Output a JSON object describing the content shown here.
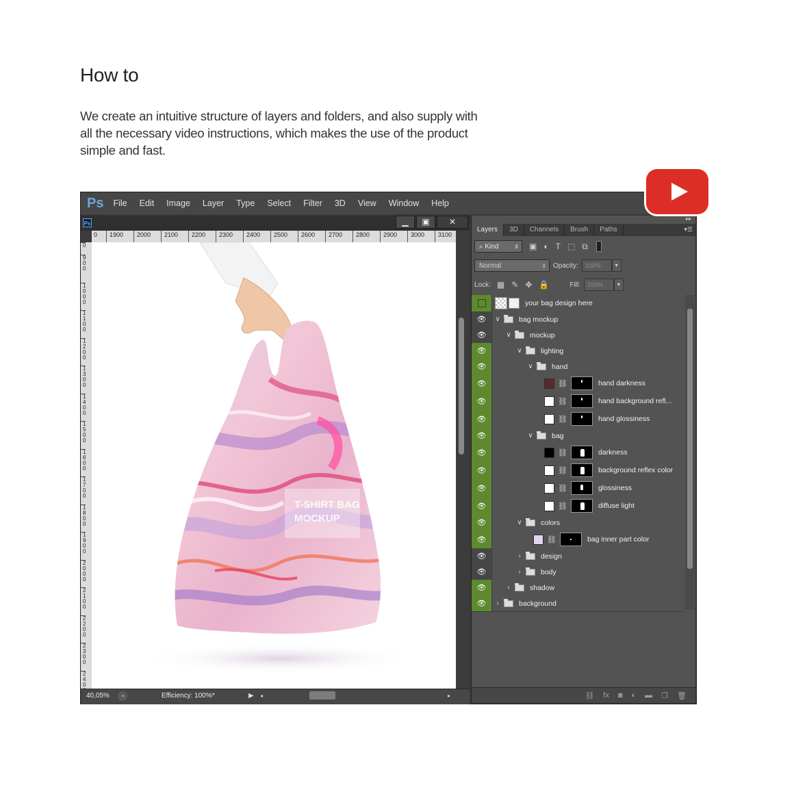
{
  "page": {
    "heading": "How to",
    "intro": "We create an intuitive structure of layers and folders, and also supply with all the necessary video instructions, which makes the use of the product simple and fast."
  },
  "colors": {
    "accent_green": "#5d8a2f",
    "youtube_red": "#dc2e27",
    "ps_blue": "#6aa7e0"
  },
  "app": {
    "logo": "Ps",
    "menu": [
      "File",
      "Edit",
      "Image",
      "Layer",
      "Type",
      "Select",
      "Filter",
      "3D",
      "View",
      "Window",
      "Help"
    ]
  },
  "document": {
    "doc_icon": "Ps",
    "ruler_h": [
      "0",
      "1900",
      "2000",
      "2100",
      "2200",
      "2300",
      "2400",
      "2500",
      "2600",
      "2700",
      "2800",
      "2900",
      "3000",
      "3100"
    ],
    "ruler_v": [
      "0",
      "900",
      "1000",
      "1100",
      "1200",
      "1300",
      "1400",
      "1500",
      "1600",
      "1700",
      "1800",
      "1900",
      "2000",
      "2100",
      "2200",
      "2300",
      "2400"
    ],
    "zoom": "40,05%",
    "efficiency": "Efficiency: 100%*",
    "bag_label": "T-SHIRT BAG\nMOCKUP"
  },
  "panel": {
    "tabs": [
      "Layers",
      "3D",
      "Channels",
      "Brush",
      "Paths"
    ],
    "kind": "Kind",
    "blend": "Normal",
    "opacity_label": "Opacity:",
    "opacity": "100%",
    "lock_label": "Lock:",
    "fill_label": "Fill:",
    "fill": "100%",
    "layers": [
      {
        "name": "your bag design here",
        "visible": false
      },
      {
        "name": "bag mockup",
        "visible": true
      },
      {
        "name": "mockup",
        "visible": true
      },
      {
        "name": "lighting",
        "visible": true
      },
      {
        "name": "hand",
        "visible": true
      },
      {
        "name": "hand darkness",
        "visible": true,
        "swatch": "#5b2b29"
      },
      {
        "name": "hand background refl...",
        "visible": true,
        "swatch": "#ffffff"
      },
      {
        "name": "hand glossiness",
        "visible": true,
        "swatch": "#ffffff"
      },
      {
        "name": "bag",
        "visible": true
      },
      {
        "name": "darkness",
        "visible": true,
        "swatch": "#000000"
      },
      {
        "name": "background reflex color",
        "visible": true,
        "swatch": "#ffffff"
      },
      {
        "name": "glossiness",
        "visible": true,
        "swatch": "#ffffff"
      },
      {
        "name": "diffuse light",
        "visible": true,
        "swatch": "#ffffff"
      },
      {
        "name": "colors",
        "visible": true
      },
      {
        "name": "bag inner part color",
        "visible": true,
        "swatch": "#e2d6ee"
      },
      {
        "name": "design",
        "visible": true
      },
      {
        "name": "body",
        "visible": true
      },
      {
        "name": "shadow",
        "visible": true
      },
      {
        "name": "background",
        "visible": true
      }
    ]
  }
}
